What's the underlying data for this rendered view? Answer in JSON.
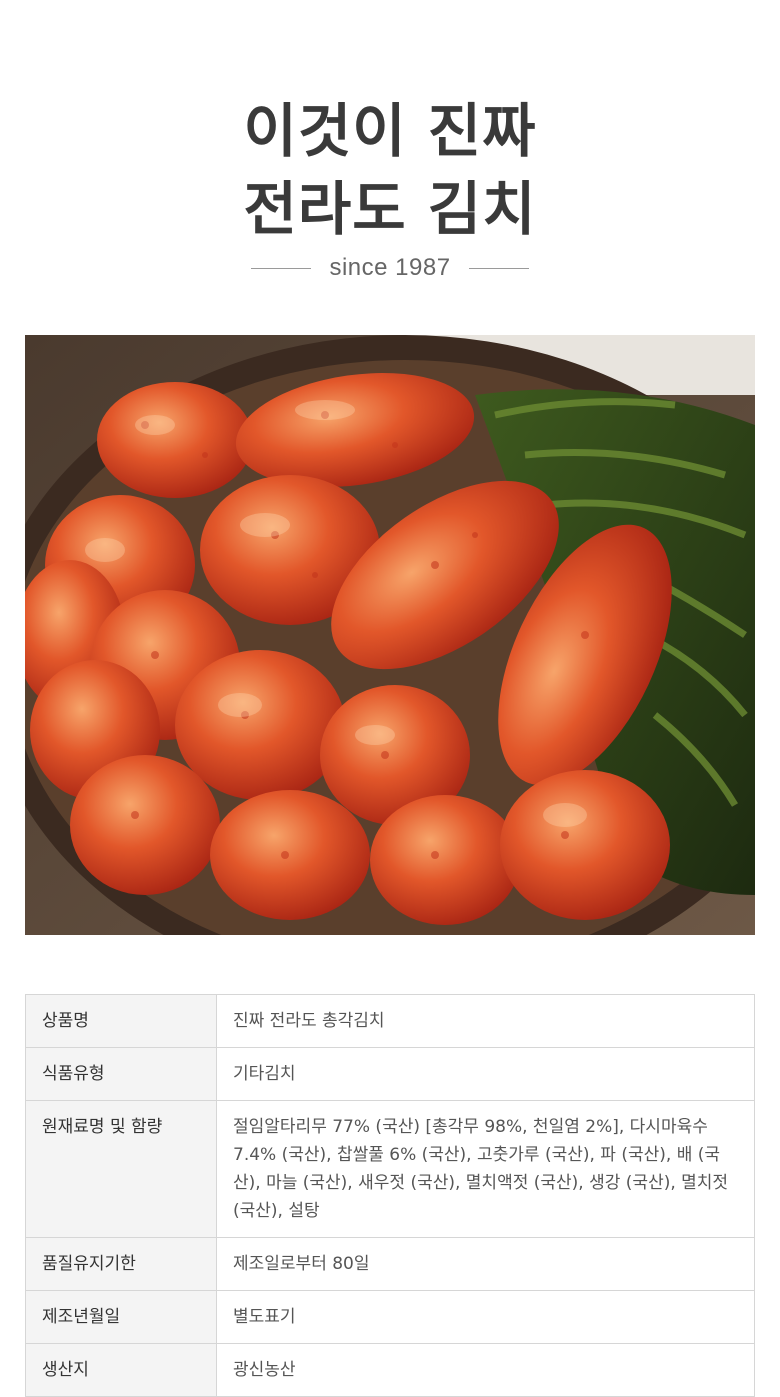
{
  "header": {
    "title_line1": "이것이 진짜",
    "title_line2": "전라도 김치",
    "since": "since 1987"
  },
  "photo": {
    "subject": "kimchi-photo"
  },
  "spec_table": {
    "rows": [
      {
        "label": "상품명",
        "value": "진짜 전라도 총각김치"
      },
      {
        "label": "식품유형",
        "value": "기타김치"
      },
      {
        "label": "원재료명 및 함량",
        "value": "절임알타리무 77% (국산) [총각무 98%, 천일염 2%], 다시마육수 7.4% (국산), 찹쌀풀 6% (국산), 고춧가루 (국산), 파 (국산), 배 (국산), 마늘 (국산), 새우젓 (국산), 멸치액젓 (국산), 생강 (국산), 멸치젓 (국산), 설탕"
      },
      {
        "label": "품질유지기한",
        "value": "제조일로부터 80일"
      },
      {
        "label": "제조년월일",
        "value": "별도표기"
      },
      {
        "label": "생산지",
        "value": "광신농산"
      }
    ]
  }
}
